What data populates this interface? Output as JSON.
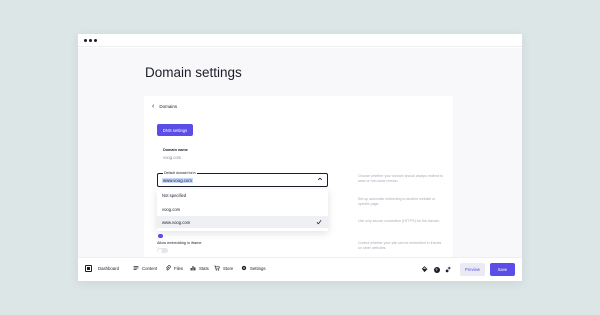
{
  "page": {
    "title": "Domain settings"
  },
  "breadcrumb": {
    "label": "Domains"
  },
  "dns_button": {
    "label": "DNS settings"
  },
  "domain_name": {
    "label": "Domain name",
    "value": "voog.com"
  },
  "default_domain_form": {
    "legend": "Default domain form",
    "value": "www.voog.com",
    "options": [
      {
        "label": "Not specified",
        "selected": false
      },
      {
        "label": "voog.com",
        "selected": false
      },
      {
        "label": "www.voog.com",
        "selected": true
      }
    ]
  },
  "embedding": {
    "label": "Allow embedding in iframe",
    "enabled": false
  },
  "help_texts": [
    "Choose whether your domain should always redirect to www or non-www version.",
    "Set up automatic redirecting to another website or specific page.",
    "Use only secure connection (HTTPS) for the domain.",
    "Control whether your site can be embedded in frames on other websites."
  ],
  "bottom_nav": [
    {
      "label": "Dashboard",
      "icon": "voog-logo-icon"
    },
    {
      "label": "Content",
      "icon": "list-icon"
    },
    {
      "label": "Files",
      "icon": "paperclip-icon"
    },
    {
      "label": "Stats",
      "icon": "bar-chart-icon"
    },
    {
      "label": "Store",
      "icon": "cart-icon"
    },
    {
      "label": "Settings",
      "icon": "gear-icon"
    }
  ],
  "actions": {
    "help_symbol": "?",
    "preview_label": "Preview",
    "save_label": "Save"
  },
  "colors": {
    "accent": "#5b4de8",
    "background": "#dce6e7",
    "text": "#1b1d2a"
  }
}
